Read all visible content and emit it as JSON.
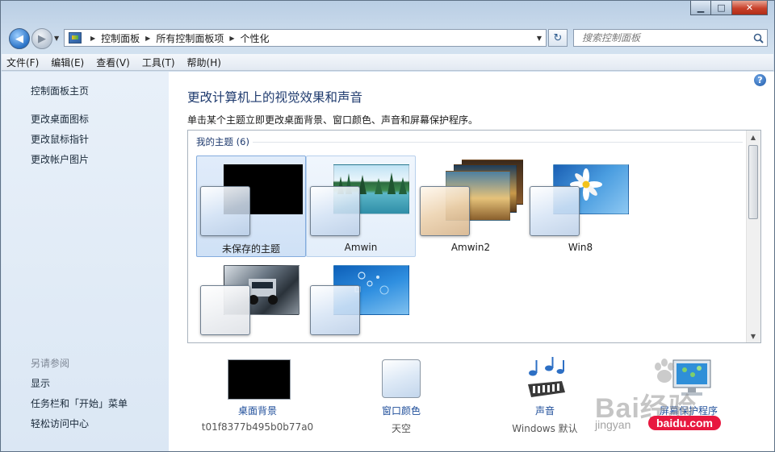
{
  "window": {
    "caption_buttons": {
      "minimize": "▁",
      "maximize": "□",
      "close": "✕"
    }
  },
  "nav": {
    "back_glyph": "◀",
    "forward_glyph": "▶",
    "breadcrumb": [
      "控制面板",
      "所有控制面板项",
      "个性化"
    ],
    "refresh_glyph": "↻",
    "search_placeholder": "搜索控制面板"
  },
  "menu": [
    "文件(F)",
    "编辑(E)",
    "查看(V)",
    "工具(T)",
    "帮助(H)"
  ],
  "sidebar": {
    "home_link": "控制面板主页",
    "links": [
      "更改桌面图标",
      "更改鼠标指针",
      "更改帐户图片"
    ],
    "see_also_heading": "另请参阅",
    "see_also": [
      "显示",
      "任务栏和「开始」菜单",
      "轻松访问中心"
    ]
  },
  "main": {
    "title": "更改计算机上的视觉效果和声音",
    "description": "单击某个主题立即更改桌面背景、窗口颜色、声音和屏幕保护程序。",
    "help_glyph": "?",
    "group_label": "我的主题 (6)",
    "themes": [
      {
        "name": "未保存的主题",
        "state": "selected",
        "preview": "black"
      },
      {
        "name": "Amwin",
        "state": "hover",
        "preview": "lake-forest"
      },
      {
        "name": "Amwin2",
        "state": "normal",
        "preview": "sunset-stack"
      },
      {
        "name": "Win8",
        "state": "normal",
        "preview": "daisy-sky"
      },
      {
        "name": "",
        "state": "normal",
        "preview": "car-city"
      },
      {
        "name": "",
        "state": "normal",
        "preview": "blue-bubbles"
      }
    ],
    "scrollbar": {
      "up": "▲",
      "down": "▼"
    }
  },
  "bottom": [
    {
      "label": "桌面背景",
      "value": "t01f8377b495b0b77a0",
      "icon": "desktop-background-icon"
    },
    {
      "label": "窗口颜色",
      "value": "天空",
      "icon": "window-color-icon"
    },
    {
      "label": "声音",
      "value": "Windows 默认",
      "icon": "sounds-icon"
    },
    {
      "label": "屏幕保护程序",
      "value": "",
      "icon": "screensaver-icon"
    }
  ],
  "watermark": {
    "logo": "Bai经验",
    "site": "jingyan",
    "badge": "baidu.com"
  },
  "colors": {
    "link_blue": "#1f4e9a",
    "title_blue": "#1e3a6e",
    "selection_border": "#84acdd",
    "close_red": "#c8412b"
  }
}
